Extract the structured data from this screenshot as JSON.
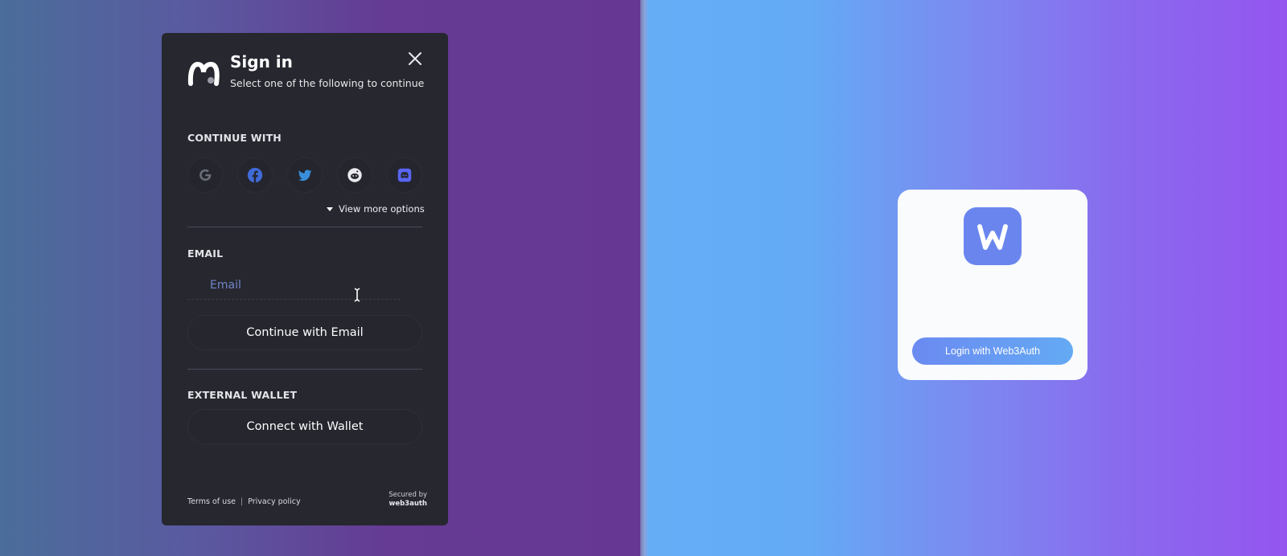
{
  "modal": {
    "title": "Sign in",
    "subtitle": "Select one of the following to continue",
    "continue_with_label": "CONTINUE WITH",
    "social": [
      {
        "icon": "google-icon"
      },
      {
        "icon": "facebook-icon"
      },
      {
        "icon": "twitter-icon"
      },
      {
        "icon": "reddit-icon"
      },
      {
        "icon": "discord-icon"
      }
    ],
    "view_more": "View more options",
    "email_label": "EMAIL",
    "email_placeholder": "Email",
    "continue_email": "Continue with Email",
    "external_wallet_label": "EXTERNAL WALLET",
    "connect_wallet": "Connect with Wallet",
    "terms": "Terms of use",
    "privacy": "Privacy policy",
    "secured_by": "Secured by",
    "secured_brand": "web3auth"
  },
  "card": {
    "login_button": "Login with Web3Auth"
  },
  "colors": {
    "modal_bg": "#26272f",
    "accent_blue": "#6a86ee",
    "google": "#6b6f78",
    "facebook": "#3f6bd8",
    "twitter": "#3a8fdc",
    "reddit": "#e9e9ee",
    "discord": "#5865f2"
  }
}
